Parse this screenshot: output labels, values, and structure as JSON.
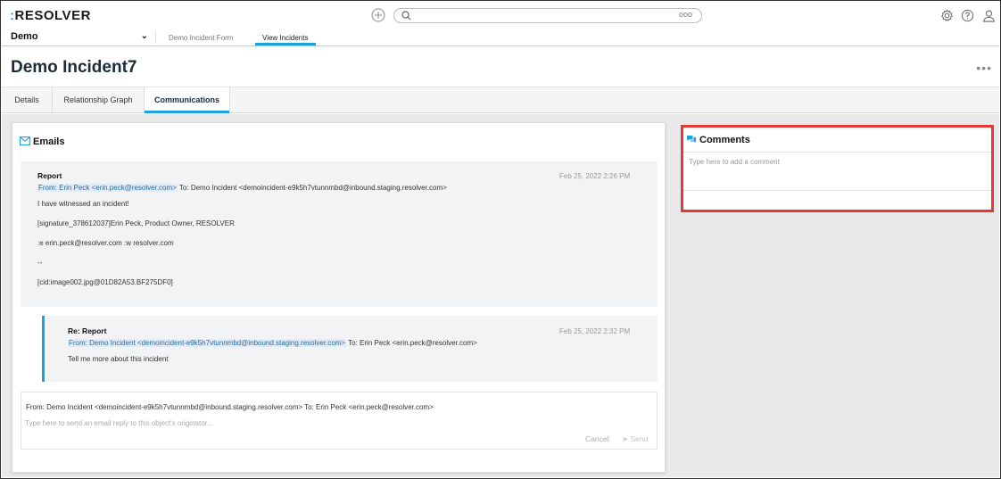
{
  "app": {
    "logo_text": "RESOLVER",
    "logo_prefix": ":",
    "search_placeholder": "",
    "search_more": "ooo"
  },
  "nav": {
    "app_name": "Demo",
    "links": [
      "Demo Incident Form",
      "View Incidents"
    ],
    "active_link": "View Incidents"
  },
  "page": {
    "title": "Demo Incident7",
    "more": "•••"
  },
  "tabs": [
    "Details",
    "Relationship Graph",
    "Communications"
  ],
  "emails": {
    "heading": "Emails",
    "messages": [
      {
        "subject": "Report",
        "date": "Feb 25, 2022 2:26 PM",
        "from": "From: Erin Peck <erin.peck@resolver.com>",
        "to": " To: Demo Incident <demoincident-e9k5h7vtunnmbd@inbound.staging.resolver.com>",
        "body": [
          "I have witnessed an incident!",
          "[signature_378612037]Erin Peck, Product Owner, RESOLVER",
          ":e erin.peck@resolver.com :w resolver.com",
          "--",
          "[cid:image002.jpg@01D82A53.BF275DF0]"
        ]
      },
      {
        "subject": "Re: Report",
        "date": "Feb 25, 2022 2:32 PM",
        "from": "From: Demo Incident <demoincident-e9k5h7vtunnmbd@inbound.staging.resolver.com>",
        "to": " To: Erin Peck <erin.peck@resolver.com>",
        "body": [
          "Tell me more about this incident"
        ]
      }
    ],
    "compose": {
      "to_line": "From: Demo Incident <demoincident-e9k5h7vtunnmbd@inbound.staging.resolver.com>   To: Erin Peck <erin.peck@resolver.com>",
      "placeholder": "Type here to send an email reply to this object's originator...",
      "cancel": "Cancel",
      "send": "Send"
    }
  },
  "comments": {
    "heading": "Comments",
    "placeholder": "Type here to add a comment"
  },
  "colors": {
    "accent": "#1aa3d9",
    "highlight_border": "#e53935",
    "title": "#1c2b3a"
  }
}
